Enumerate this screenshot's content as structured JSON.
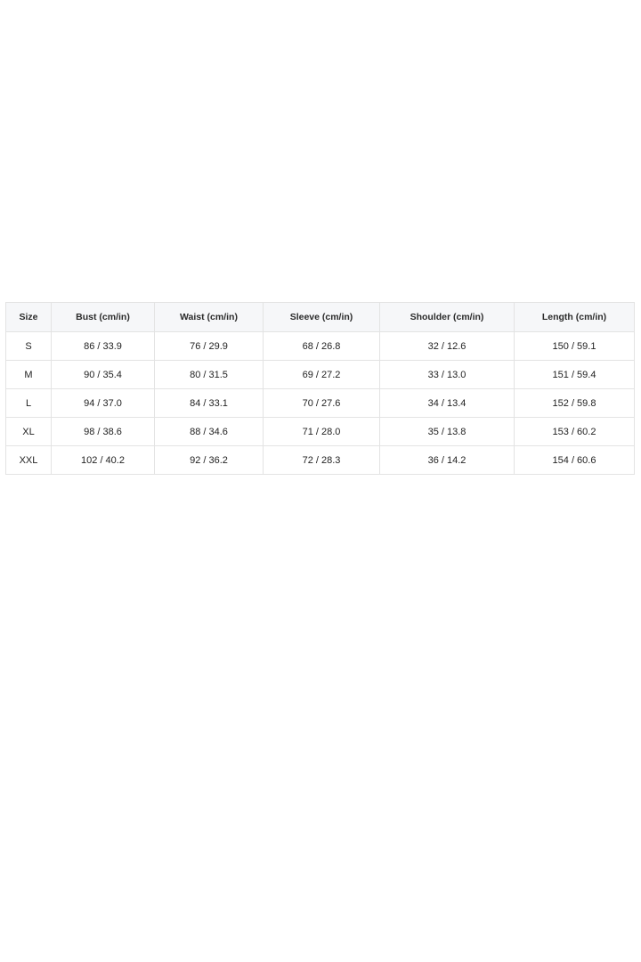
{
  "size_chart": {
    "headers": [
      "Size",
      "Bust (cm/in)",
      "Waist (cm/in)",
      "Sleeve (cm/in)",
      "Shoulder (cm/in)",
      "Length (cm/in)"
    ],
    "rows": [
      [
        "S",
        "86 / 33.9",
        "76 / 29.9",
        "68 / 26.8",
        "32 / 12.6",
        "150 / 59.1"
      ],
      [
        "M",
        "90 / 35.4",
        "80 / 31.5",
        "69 / 27.2",
        "33 / 13.0",
        "151 / 59.4"
      ],
      [
        "L",
        "94 / 37.0",
        "84 / 33.1",
        "70 / 27.6",
        "34 / 13.4",
        "152 / 59.8"
      ],
      [
        "XL",
        "98 / 38.6",
        "88 / 34.6",
        "71 / 28.0",
        "35 / 13.8",
        "153 / 60.2"
      ],
      [
        "XXL",
        "102 / 40.2",
        "92 / 36.2",
        "72 / 28.3",
        "36 / 14.2",
        "154 / 60.6"
      ]
    ]
  }
}
